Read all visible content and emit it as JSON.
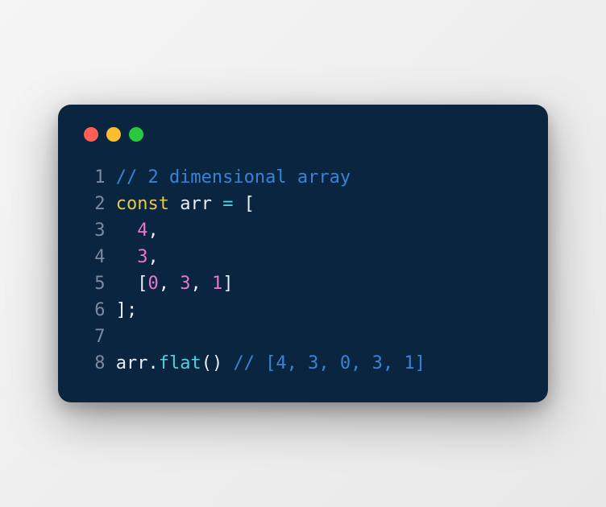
{
  "code": {
    "lines": [
      {
        "n": "1"
      },
      {
        "n": "2"
      },
      {
        "n": "3"
      },
      {
        "n": "4"
      },
      {
        "n": "5"
      },
      {
        "n": "6"
      },
      {
        "n": "7"
      },
      {
        "n": "8"
      }
    ],
    "l1_comment": "// 2 dimensional array",
    "l2_keyword": "const",
    "l2_ident": " arr ",
    "l2_op": "=",
    "l2_punct": " [",
    "l3_indent": "  ",
    "l3_num": "4",
    "l3_punct": ",",
    "l4_indent": "  ",
    "l4_num": "3",
    "l4_punct": ",",
    "l5_indent": "  ",
    "l5_b1": "[",
    "l5_n1": "0",
    "l5_c1": ", ",
    "l5_n2": "3",
    "l5_c2": ", ",
    "l5_n3": "1",
    "l5_b2": "]",
    "l6_punct": "];",
    "l7_blank": "",
    "l8_ident": "arr",
    "l8_dot": ".",
    "l8_method": "flat",
    "l8_paren": "() ",
    "l8_comment": "// [4, 3, 0, 3, 1]"
  }
}
